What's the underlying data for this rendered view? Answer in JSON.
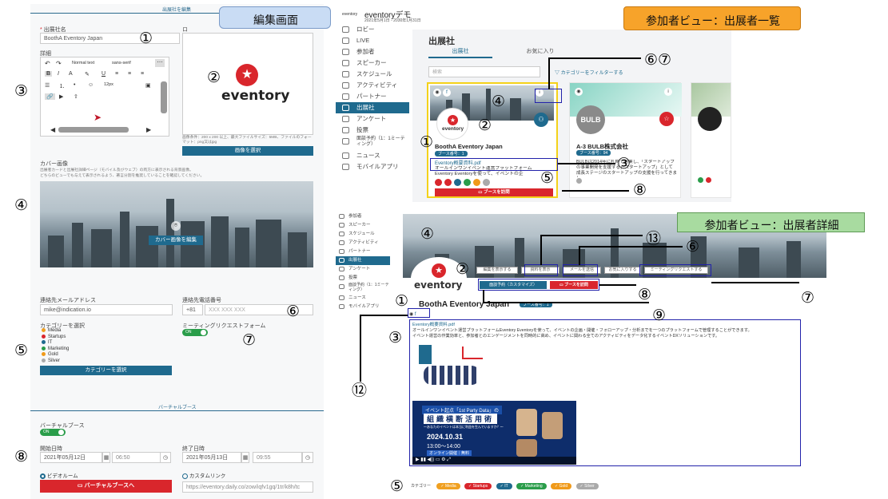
{
  "banners": {
    "edit": "編集画面",
    "list": "参加者ビュー：出展者一覧",
    "detail": "参加者ビュー：出展者詳細"
  },
  "markers": {
    "m1": "①",
    "m2": "②",
    "m3": "③",
    "m4": "④",
    "m5": "⑤",
    "m6": "⑥",
    "m7": "⑦",
    "m8": "⑧",
    "m9": "⑨",
    "m12": "⑫",
    "m13": "⑬",
    "m67": "⑥⑦"
  },
  "edit": {
    "header": "出展社を編集",
    "name_label": "出展社名",
    "name_value": "BoothA Eventory Japan",
    "logo_label": "ロ",
    "logo_text": "eventory",
    "desc_label": "詳細",
    "toolbar": {
      "style": "Normal text",
      "font": "sans-serif",
      "size": "12px"
    },
    "logo_note": "画像条件：200 x 200 以上、最大ファイルサイズ：5MB、ファイルのフォーマット：png又はjpg",
    "logo_button": "画像を選択",
    "cover_label": "カバー画像",
    "cover_note1": "出展者カードと出展社詳細ページ（モバイル及びウェブ）の両方に表示される背景画像。",
    "cover_note2": "どちらのビューでも与えて表示されるよう、著言分割を推奨していることを確認してください。",
    "cover_button": "カバー画像を編集",
    "email_label": "連絡先メールアドレス",
    "email_value": "mike@indication.io",
    "phone_label": "連絡先電話番号",
    "phone_code": "+81",
    "phone_placeholder": "XXX XXX XXX",
    "category_label": "カテゴリーを選択",
    "categories": [
      {
        "name": "Media",
        "color": "#f0a020"
      },
      {
        "name": "Startups",
        "color": "#d9262c"
      },
      {
        "name": "IT",
        "color": "#1f6a8e"
      },
      {
        "name": "Marketing",
        "color": "#2a9d4a"
      },
      {
        "name": "Gold",
        "color": "#f09a1a"
      },
      {
        "name": "Silver",
        "color": "#aaaaaa"
      }
    ],
    "category_button": "カテゴリーを選択",
    "meeting_label": "ミーティングリクエストフォーム",
    "meeting_toggle": "ON",
    "virtual_header": "バーチャルブース",
    "virtual_label": "バーチャルブース",
    "virtual_toggle": "ON",
    "start_label": "開始日時",
    "start_date": "2021年05月12日",
    "start_time": "06:50",
    "end_label": "終了日時",
    "end_date": "2021年05月13日",
    "end_time": "09:55",
    "video_room": "ビデオルーム",
    "custom_link": "カスタムリンク",
    "virtual_button": "バーチャルブースへ",
    "link_value": "https://eventory.daily.co/zow/iqfv1gq/1tr/k8h/tc"
  },
  "list": {
    "app_name": "eventoryデモ",
    "app_dates": "2021年5月1日 - 2030年1月31日",
    "brand": "eventory",
    "nav": [
      "ロビー",
      "LIVE",
      "参加者",
      "スピーカー",
      "スケジュール",
      "アクティビティ",
      "パートナー",
      "出展社",
      "アンケート",
      "投票",
      "面談予約（1：1ミーティング）",
      "ニュース",
      "モバイルアプリ"
    ],
    "active_nav": "出展社",
    "page_title": "出展社",
    "tab_exhibitors": "出展社",
    "tab_favorites": "お気に入り",
    "search_placeholder": "検索",
    "filter_label": "カテゴリーをフィルターする",
    "card1": {
      "name": "BoothA Eventory Japan",
      "booth": "ブース番号：1",
      "file": "Eventory概要資料.pdf",
      "desc": "オールインワンイベント運営プラットフォーム Eventory Eventoryを使って、イベントの企",
      "button": "ブースを訪問"
    },
    "card2": {
      "name": "A-3 BULB株式会社",
      "booth": "ブース番号：94",
      "desc": "BULBは2014年に札幌で創業し、「スタートアップの事業開発を支援する」スタートアップ」として成長ステージのスタートアップの支援を行ってきまし...",
      "logo": "BULB"
    }
  },
  "detail": {
    "nav": [
      "参加者",
      "スピーカー",
      "スケジュール",
      "アクティビティ",
      "パートナー",
      "出展社",
      "アンケート",
      "投票",
      "面談予約（1：1ミーティング）",
      "ニュース",
      "モバイルアプリ"
    ],
    "active_nav": "出展社",
    "name": "BoothA Eventory Japan",
    "booth": "ブース番号：1",
    "file": "Eventory概要資料.pdf",
    "btn_share": "編集を表示する",
    "btn_doc": "資料を表示",
    "btn_mail": "メールを送信",
    "btn_fav": "お気に入りする",
    "btn_meeting": "ミーティングリクエストする",
    "btn_booking": "面談予約（カスタマイズ）",
    "btn_visit": "ブースを訪問",
    "desc": "オールインワンイベント運営プラットフォームEventory Eventoryを使って、イベントの企画・開催・フォローアップ・分析までを一つのプラットフォームで管理することができます。",
    "desc2": "イベント運営の作業効率と、参加者とのエンゲージメントを同時的に高め、イベントに関わる全てのアクティビティをデータ化するイベントDXソリューションです。",
    "video_title1": "イベント起点「1st Party Data」の",
    "video_title2": "組織横断活用術",
    "video_sub": "〜あなたのイベントは本当に利益を生んでいますか？〜",
    "video_date": "2024.10.31",
    "video_time": "13:00〜14:00",
    "video_note": "オンライン開催｜無料",
    "category_label": "カテゴリー",
    "categories": [
      {
        "name": "Media",
        "color": "#f0a020"
      },
      {
        "name": "Startups",
        "color": "#d9262c"
      },
      {
        "name": "IT",
        "color": "#1f6a8e"
      },
      {
        "name": "Marketing",
        "color": "#2a9d4a"
      },
      {
        "name": "Gold",
        "color": "#f09a1a"
      },
      {
        "name": "Silver",
        "color": "#aaaaaa"
      }
    ]
  }
}
